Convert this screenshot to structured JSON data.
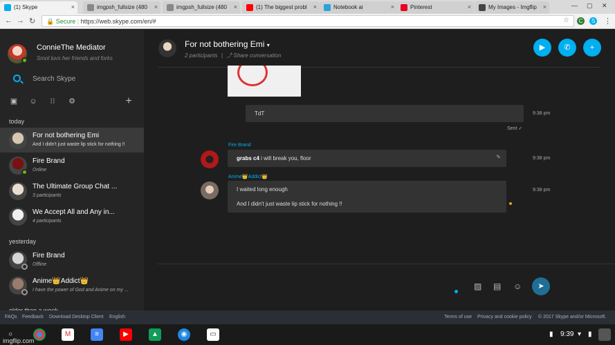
{
  "browser": {
    "tabs": [
      {
        "title": "(1) Skype",
        "active": true,
        "icon_color": "#00aff0"
      },
      {
        "title": "imgpsh_fullsize (480",
        "active": false,
        "icon_color": "#888888"
      },
      {
        "title": "imgpsh_fullsize (480",
        "active": false,
        "icon_color": "#888888"
      },
      {
        "title": "(1) The biggest probl",
        "active": false,
        "icon_color": "#ff0000"
      },
      {
        "title": "Notebook ai",
        "active": false,
        "icon_color": "#2aa3d8"
      },
      {
        "title": "Pinterest",
        "active": false,
        "icon_color": "#e60023"
      },
      {
        "title": "My Images - Imgflip",
        "active": false,
        "icon_color": "#444444"
      }
    ],
    "secure_label": "Secure",
    "url": "https://web.skype.com/en/#"
  },
  "profile": {
    "name": "ConnieThe Mediator",
    "mood": "Smol luvs her friends and forks",
    "status": "online"
  },
  "search": {
    "placeholder": "Search Skype"
  },
  "sections": [
    {
      "label": "today"
    },
    {
      "label": "yesterday"
    },
    {
      "label": "older than a week"
    }
  ],
  "chats": [
    {
      "name": "For not bothering Emi",
      "subtitle": "And I didn't just waste lip stick for nothing !!",
      "selected": true,
      "avatar_color": "#d8c6b4",
      "status": "none"
    },
    {
      "name": "Fire Brand",
      "subtitle": "Online",
      "selected": false,
      "avatar_color": "#7a1010",
      "status": "online"
    },
    {
      "name": "The Ultimate Group Chat ...",
      "subtitle": "3 participants",
      "selected": false,
      "avatar_color": "#e8ddd0",
      "status": "none"
    },
    {
      "name": "We Accept All and Any in...",
      "subtitle": "4 participants",
      "selected": false,
      "avatar_color": "#f0f0f0",
      "status": "none"
    },
    {
      "name": "Fire Brand",
      "subtitle": "Offline",
      "selected": false,
      "avatar_color": "#d6d6d6",
      "status": "offline"
    },
    {
      "name": "Anime👑Addict👑",
      "subtitle": "I have the power of God and Anime on my ...",
      "selected": false,
      "avatar_color": "#9b7b6b",
      "status": "offline"
    }
  ],
  "conversation": {
    "title": "For not bothering Emi",
    "participants": "2 participants",
    "share": "Share conversation"
  },
  "messages": {
    "own": {
      "text": "TdT",
      "time": "9:38 pm",
      "status": "Sent"
    },
    "fire": {
      "sender": "Fire Brand",
      "bold": "grabs c4",
      "text": " i will break you, floor",
      "time": "9:38 pm"
    },
    "anime": {
      "sender": "Anime👑Addict👑",
      "line1": "I waited long enough",
      "line2": "And I didn't just waste lip stick for nothing !!",
      "time": "9:38 pm"
    }
  },
  "footer": {
    "links": [
      "FAQs",
      "Feedback",
      "Download Desktop Client",
      "English"
    ],
    "right": [
      "Terms of use",
      "Privacy and cookie policy",
      "© 2017 Skype and/or Microsoft."
    ]
  },
  "taskbar": {
    "time": "9:39"
  },
  "watermark": "imgflip.com",
  "colors": {
    "accent": "#00aff0",
    "online": "#6bb700"
  }
}
